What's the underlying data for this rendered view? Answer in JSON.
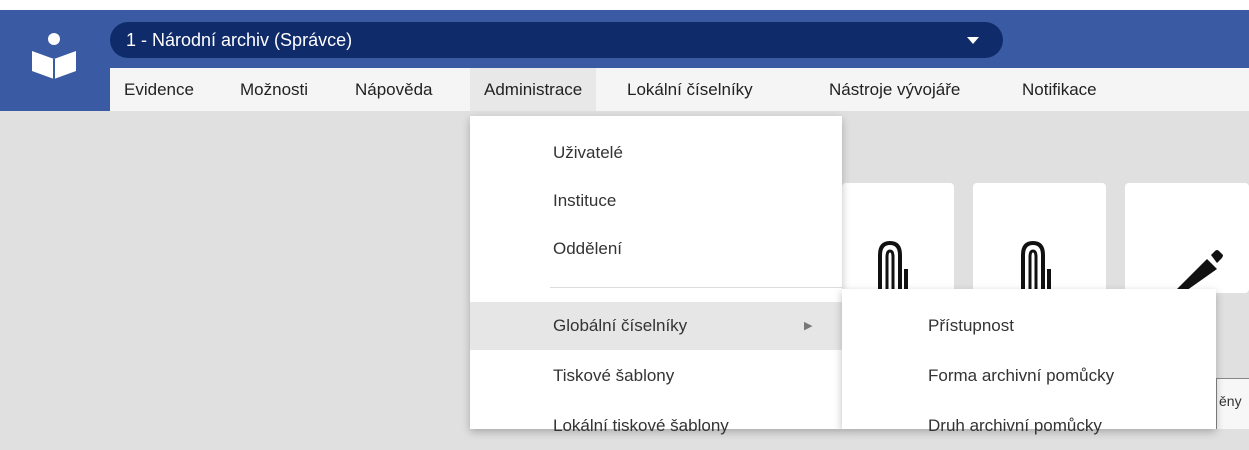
{
  "app": {
    "selector_label": "1 - Národní archiv (Správce)"
  },
  "menu": {
    "items": [
      {
        "label": "Evidence"
      },
      {
        "label": "Možnosti"
      },
      {
        "label": "Nápověda"
      },
      {
        "label": "Administrace"
      },
      {
        "label": "Lokální číselníky"
      },
      {
        "label": "Nástroje vývojáře"
      },
      {
        "label": "Notifikace"
      }
    ]
  },
  "administrace_menu": {
    "items": [
      {
        "label": "Uživatelé"
      },
      {
        "label": "Instituce"
      },
      {
        "label": "Oddělení"
      },
      {
        "label": "Globální číselníky"
      },
      {
        "label": "Tiskové šablony"
      },
      {
        "label": "Lokální tiskové šablony"
      }
    ]
  },
  "global_codelists_submenu": {
    "items": [
      {
        "label": "Přístupnost"
      },
      {
        "label": "Forma archivní pomůcky"
      },
      {
        "label": "Druh archivní pomůcky"
      }
    ]
  },
  "cards": [
    {
      "icon": "attachment-icon"
    },
    {
      "icon": "attachment-icon"
    },
    {
      "icon": "pencil-icon"
    }
  ],
  "partial_label": "ěny",
  "colors": {
    "app_bar": "#3a5aa3",
    "selector": "#0f2b6a",
    "menu_bar": "#f5f5f5",
    "background": "#e0e0e0"
  }
}
